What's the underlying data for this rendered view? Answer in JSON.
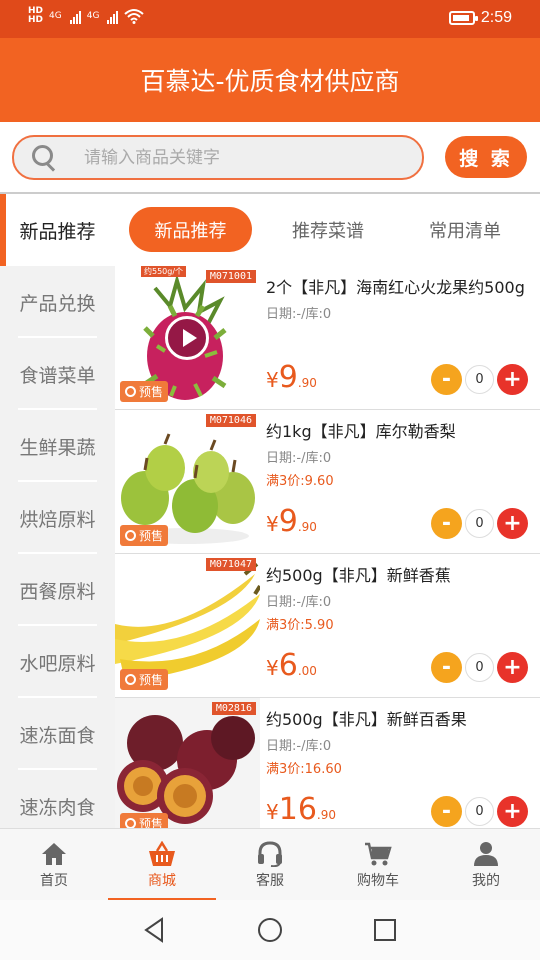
{
  "status": {
    "network1": "4G",
    "network2": "4G",
    "time": "2:59"
  },
  "header": {
    "title": "百慕达-优质食材供应商"
  },
  "search": {
    "placeholder": "请输入商品关键字",
    "button": "搜 索"
  },
  "sidebar": {
    "items": [
      {
        "label": "新品推荐"
      },
      {
        "label": "产品兑换"
      },
      {
        "label": "食谱菜单"
      },
      {
        "label": "生鲜果蔬"
      },
      {
        "label": "烘焙原料"
      },
      {
        "label": "西餐原料"
      },
      {
        "label": "水吧原料"
      },
      {
        "label": "速冻面食"
      },
      {
        "label": "速冻肉食"
      }
    ]
  },
  "tabs": [
    {
      "label": "新品推荐"
    },
    {
      "label": "推荐菜谱"
    },
    {
      "label": "常用清单"
    }
  ],
  "products": [
    {
      "code": "M071001",
      "top_label": "约550g/个",
      "name": "2个【非凡】海南红心火龙果约500g",
      "date": "日期:-/库:0",
      "deal": "",
      "price_cur": "¥",
      "price_int": "9",
      "price_dec": ".90",
      "qty": "0",
      "presale": "预售"
    },
    {
      "code": "M071046",
      "name": "约1kg【非凡】库尔勒香梨",
      "date": "日期:-/库:0",
      "deal": "满3价:9.60",
      "price_cur": "¥",
      "price_int": "9",
      "price_dec": ".90",
      "qty": "0",
      "presale": "预售"
    },
    {
      "code": "M071047",
      "name": "约500g【非凡】新鲜香蕉",
      "date": "日期:-/库:0",
      "deal": "满3价:5.90",
      "price_cur": "¥",
      "price_int": "6",
      "price_dec": ".00",
      "qty": "0",
      "presale": "预售"
    },
    {
      "code": "M02816",
      "name": "约500g【非凡】新鲜百香果",
      "date": "日期:-/库:0",
      "deal": "满3价:16.60",
      "price_cur": "¥",
      "price_int": "16",
      "price_dec": ".90",
      "qty": "0",
      "presale": "预售"
    }
  ],
  "qty_controls": {
    "minus": "-",
    "plus": "+"
  },
  "bottomnav": [
    {
      "label": "首页",
      "icon": "home-icon"
    },
    {
      "label": "商城",
      "icon": "basket-icon"
    },
    {
      "label": "客服",
      "icon": "headset-icon"
    },
    {
      "label": "购物车",
      "icon": "cart-icon"
    },
    {
      "label": "我的",
      "icon": "person-icon"
    }
  ],
  "colors": {
    "brand": "#f26322",
    "status_bar": "#e04a1a",
    "price": "#e85a1e",
    "minus": "#f5a41e",
    "plus": "#e8332a"
  }
}
